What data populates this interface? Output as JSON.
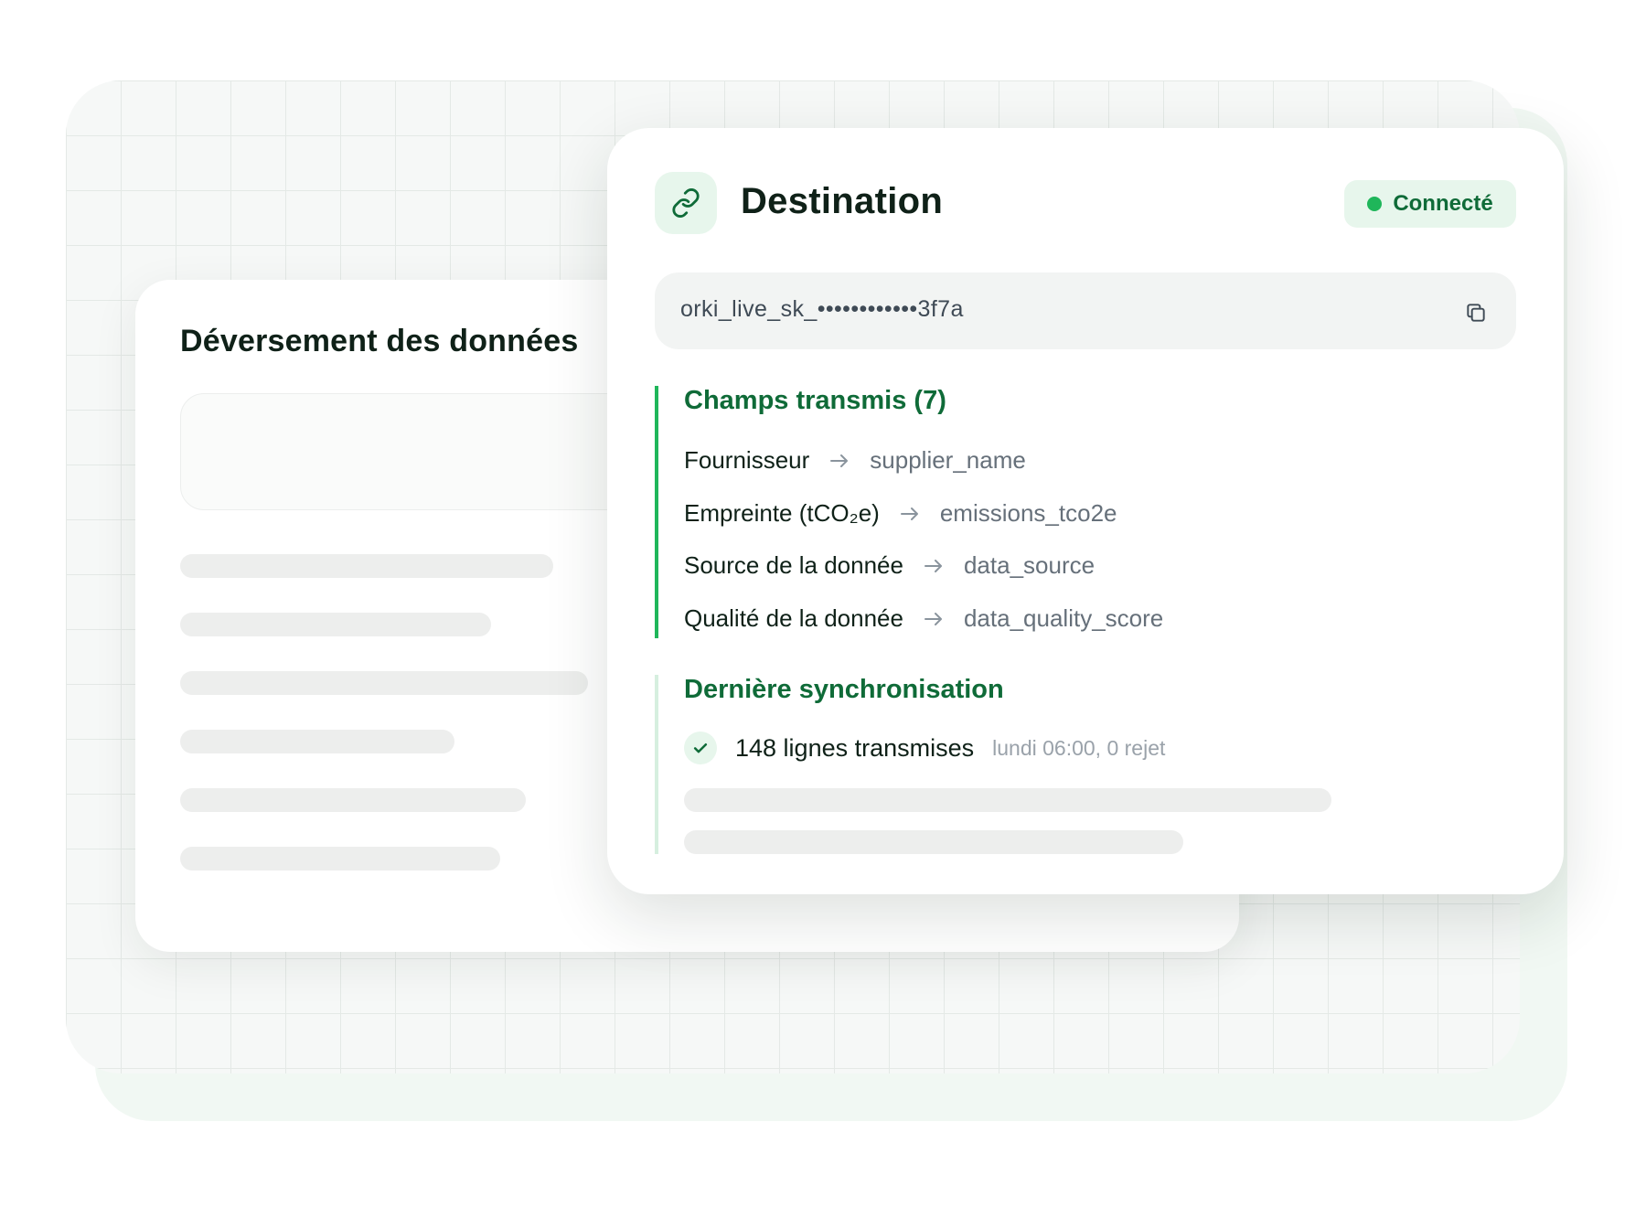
{
  "back_card": {
    "title": "Déversement des données"
  },
  "destination": {
    "title": "Destination",
    "icon": "link-icon",
    "status": {
      "label": "Connecté",
      "color": "#1fb65a"
    },
    "api_key": {
      "value": "orki_live_sk_••••••••••••3f7a",
      "copy_icon": "copy-icon"
    },
    "fields": {
      "title": "Champs transmis (7)",
      "items": [
        {
          "source": "Fournisseur",
          "target": "supplier_name"
        },
        {
          "source": "Empreinte (tCO₂e)",
          "target": "emissions_tco2e"
        },
        {
          "source": "Source de la donnée",
          "target": "data_source"
        },
        {
          "source": "Qualité de la donnée",
          "target": "data_quality_score"
        }
      ]
    },
    "sync": {
      "title": "Dernière synchronisation",
      "count": "148 lignes transmises",
      "meta": "lundi 06:00, 0 rejet"
    }
  },
  "colors": {
    "accent": "#1fb65a",
    "accent_dark": "#0f6b38",
    "accent_bg": "#e7f6ec",
    "text": "#0f2118"
  }
}
